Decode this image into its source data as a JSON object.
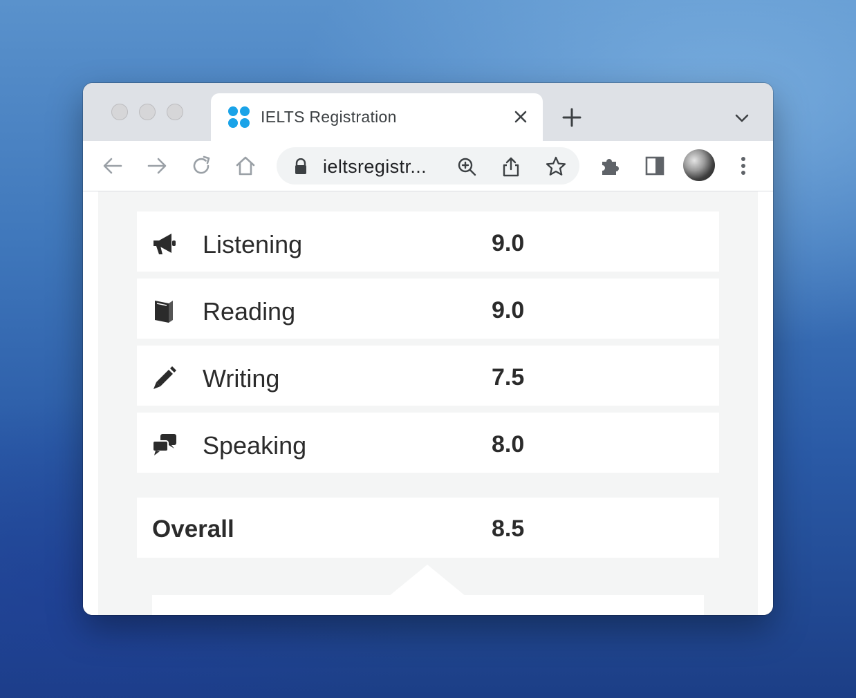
{
  "browser": {
    "tab_title": "IELTS Registration",
    "url": "ieltsregistr...",
    "favicon_color": "#1aa3e8"
  },
  "scores": [
    {
      "icon": "megaphone-icon",
      "label": "Listening",
      "score": "9.0"
    },
    {
      "icon": "book-icon",
      "label": "Reading",
      "score": "9.0"
    },
    {
      "icon": "pencil-icon",
      "label": "Writing",
      "score": "7.5"
    },
    {
      "icon": "comments-icon",
      "label": "Speaking",
      "score": "8.0"
    }
  ],
  "overall": {
    "label": "Overall",
    "score": "8.5"
  }
}
